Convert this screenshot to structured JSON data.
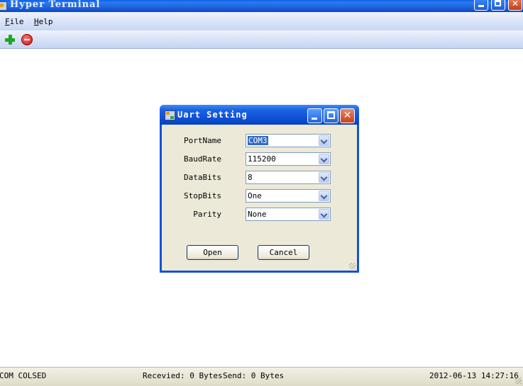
{
  "window": {
    "title": "Hyper Terminal"
  },
  "menu": {
    "items": [
      {
        "label": "File",
        "accel": "F",
        "rest": "ile"
      },
      {
        "label": "Help",
        "accel": "H",
        "rest": "elp"
      }
    ]
  },
  "toolbar": {
    "icons": [
      "plus-icon",
      "stop-icon"
    ],
    "colors": {
      "plus": "#1ea61e",
      "stop": "#cc0b0b"
    }
  },
  "dialog": {
    "title": "Uart Setting",
    "fields": [
      {
        "label": "PortName",
        "value": "COM3"
      },
      {
        "label": "BaudRate",
        "value": "115200"
      },
      {
        "label": "DataBits",
        "value": "8"
      },
      {
        "label": "StopBits",
        "value": "One"
      },
      {
        "label": "Parity",
        "value": "None"
      }
    ],
    "buttons": {
      "open": "Open",
      "cancel": "Cancel"
    }
  },
  "status": {
    "connection": "COM COLSED",
    "received": "Recevied: 0 Bytes",
    "send": "Send: 0 Bytes",
    "datetime": "2012-06-13 14:27:16"
  }
}
